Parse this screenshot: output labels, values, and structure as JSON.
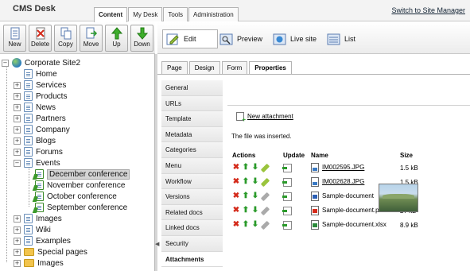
{
  "header": {
    "logo_cms": "CMS",
    "logo_desk": "Desk",
    "tabs": [
      "Content",
      "My Desk",
      "Tools",
      "Administration"
    ],
    "switch_link": "Switch to Site Manager"
  },
  "toolbar": {
    "buttons": [
      "New",
      "Delete",
      "Copy",
      "Move",
      "Up",
      "Down"
    ]
  },
  "modes": {
    "edit": "Edit",
    "preview": "Preview",
    "live_site": "Live site",
    "list": "List"
  },
  "tree": {
    "root": "Corporate Site2",
    "items": [
      "Home",
      "Services",
      "Products",
      "News",
      "Partners",
      "Company",
      "Blogs",
      "Forums",
      "Events",
      "December conference",
      "November conference",
      "October conference",
      "September conference",
      "Images",
      "Wiki",
      "Examples",
      "Special pages",
      "Images"
    ]
  },
  "sub_tabs": [
    "Page",
    "Design",
    "Form",
    "Properties"
  ],
  "prop_menu": [
    "General",
    "URLs",
    "Template",
    "Metadata",
    "Categories",
    "Menu",
    "Workflow",
    "Versions",
    "Related docs",
    "Linked docs",
    "Security",
    "Attachments"
  ],
  "content": {
    "new_attachment": "New attachment",
    "message": "The file was inserted.",
    "columns": {
      "actions": "Actions",
      "update": "Update",
      "name": "Name",
      "size": "Size"
    },
    "rows": [
      {
        "name": "IM002595.JPG",
        "size": "1.5 kB",
        "type": "jpg"
      },
      {
        "name": "IM002628.JPG",
        "size": "1.5 kB",
        "type": "jpg"
      },
      {
        "name": "Sample-document",
        "size": "",
        "type": "doc"
      },
      {
        "name": "Sample-document.pdf",
        "size": "27 kB",
        "type": "pdf"
      },
      {
        "name": "Sample-document.xlsx",
        "size": "8.9 kB",
        "type": "xls"
      }
    ]
  }
}
